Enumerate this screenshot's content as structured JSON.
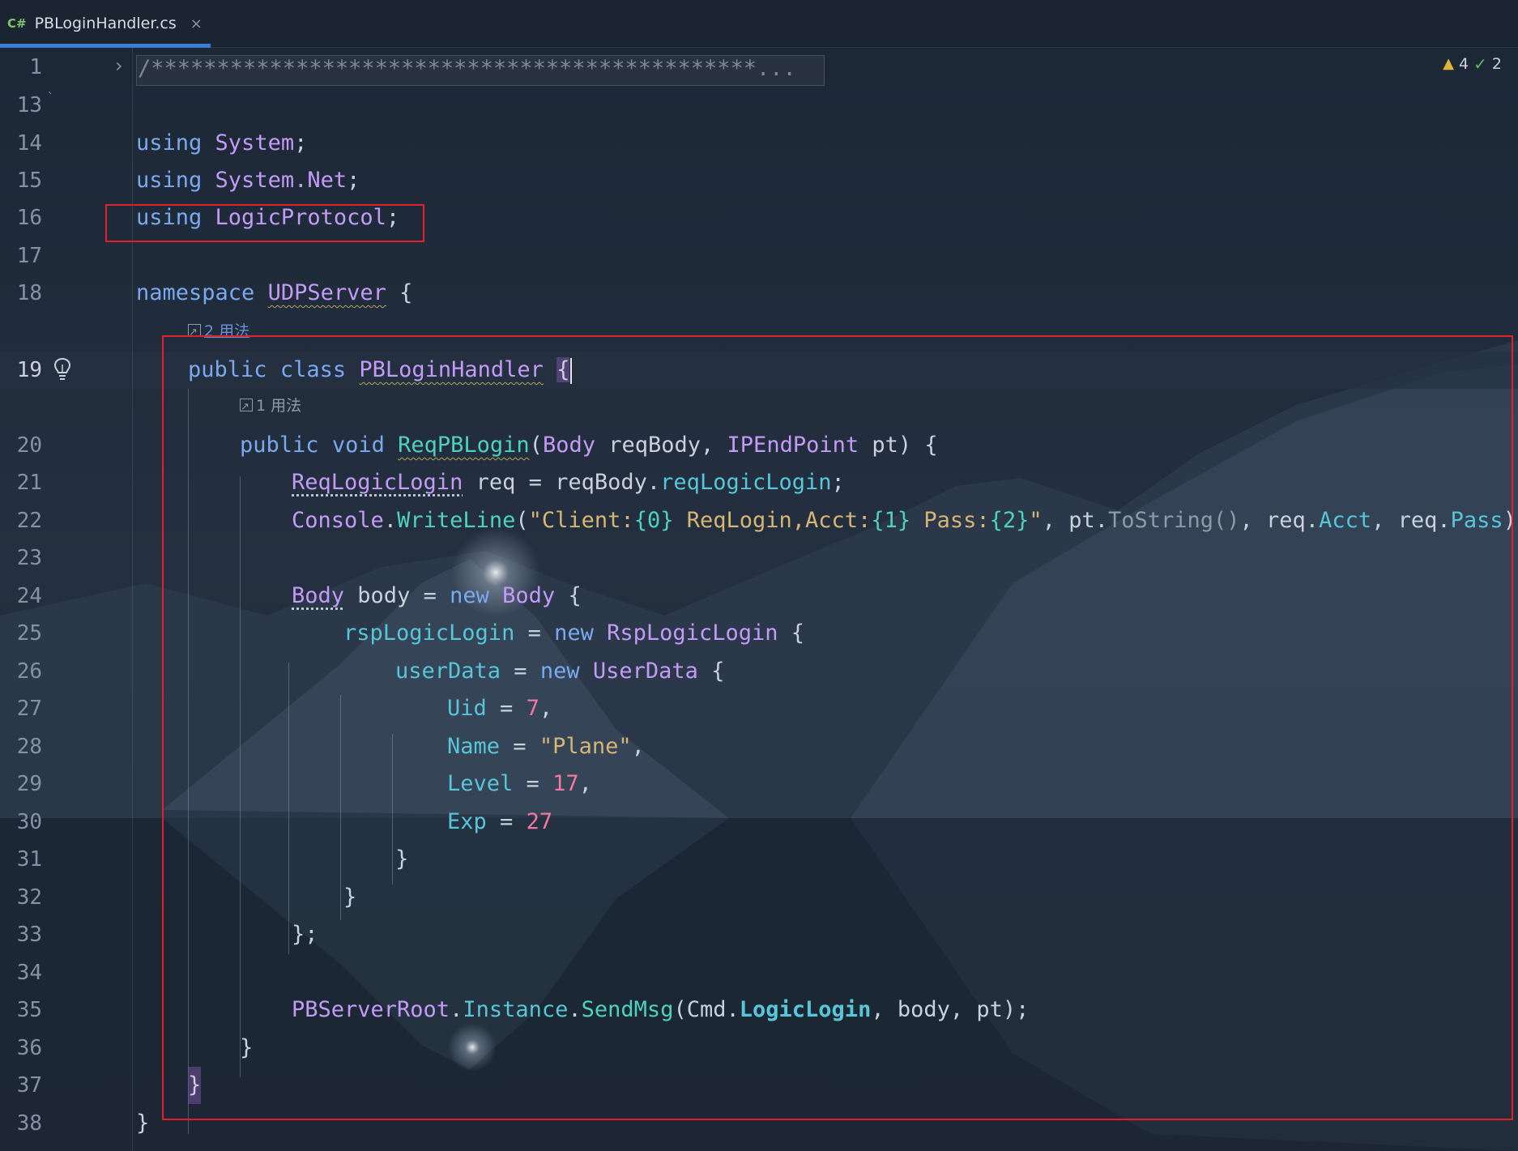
{
  "tab": {
    "lang": "C#",
    "filename": "PBLoginHandler.cs",
    "close": "×"
  },
  "inspections": {
    "warnings": "4",
    "ok": "2"
  },
  "usages": {
    "class": "2 用法",
    "method": "1 用法"
  },
  "line_numbers": [
    "1",
    "13",
    "14",
    "15",
    "16",
    "17",
    "18",
    "19",
    "20",
    "21",
    "22",
    "23",
    "24",
    "25",
    "26",
    "27",
    "28",
    "29",
    "30",
    "31",
    "32",
    "33",
    "34",
    "35",
    "36",
    "37",
    "38"
  ],
  "code": {
    "l1": "/**********************************************...",
    "l13": "`",
    "l14": [
      "using",
      "System",
      ";"
    ],
    "l15": [
      "using",
      "System.Net",
      ";"
    ],
    "l16": [
      "using",
      "LogicProtocol",
      ";"
    ],
    "l18": [
      "namespace",
      "UDPServer",
      "{"
    ],
    "l19": [
      "public",
      "class",
      "PBLoginHandler",
      "{"
    ],
    "l20": [
      "public",
      "void",
      "ReqPBLogin",
      "(",
      "Body",
      "reqBody,",
      "IPEndPoint",
      "pt) {"
    ],
    "l21": [
      "ReqLogicLogin",
      "req = reqBody.",
      "reqLogicLogin",
      ";"
    ],
    "l22": [
      "Console",
      ".",
      "WriteLine",
      "(",
      "\"Client:",
      "{0}",
      " ReqLogin,Acct:",
      "{1}",
      " Pass:",
      "{2}",
      "\"",
      ", pt.",
      "ToString()",
      ", req.",
      "Acct",
      ", req.",
      "Pass",
      ");"
    ],
    "l24": [
      "Body",
      "body = ",
      "new",
      "Body",
      "{"
    ],
    "l25": [
      "rspLogicLogin",
      " = ",
      "new",
      "RspLogicLogin",
      "{"
    ],
    "l26": [
      "userData",
      " = ",
      "new",
      "UserData",
      "{"
    ],
    "l27": [
      "Uid",
      " = ",
      "7",
      ","
    ],
    "l28": [
      "Name",
      " = ",
      "\"Plane\"",
      ","
    ],
    "l29": [
      "Level",
      " = ",
      "17",
      ","
    ],
    "l30": [
      "Exp",
      " = ",
      "27"
    ],
    "l31": "}",
    "l32": "}",
    "l33": "};",
    "l35": [
      "PBServerRoot",
      ".",
      "Instance",
      ".",
      "SendMsg",
      "(",
      "Cmd",
      ".",
      "LogicLogin",
      ", body, pt);"
    ],
    "l36": "}",
    "l37": "}",
    "l38": "}"
  },
  "colors": {
    "keyword": "#7aa9f0",
    "type": "#c39bf7",
    "method": "#4ed2bf",
    "string": "#d6b575",
    "number": "#f078a3",
    "highlight_box": "#e0202a",
    "tab_underline": "#3a7dd4"
  },
  "icons": {
    "fold": "chevron-right-icon",
    "gutter": "lightbulb-icon",
    "warning": "warning-icon",
    "ok": "checkmark-icon"
  }
}
